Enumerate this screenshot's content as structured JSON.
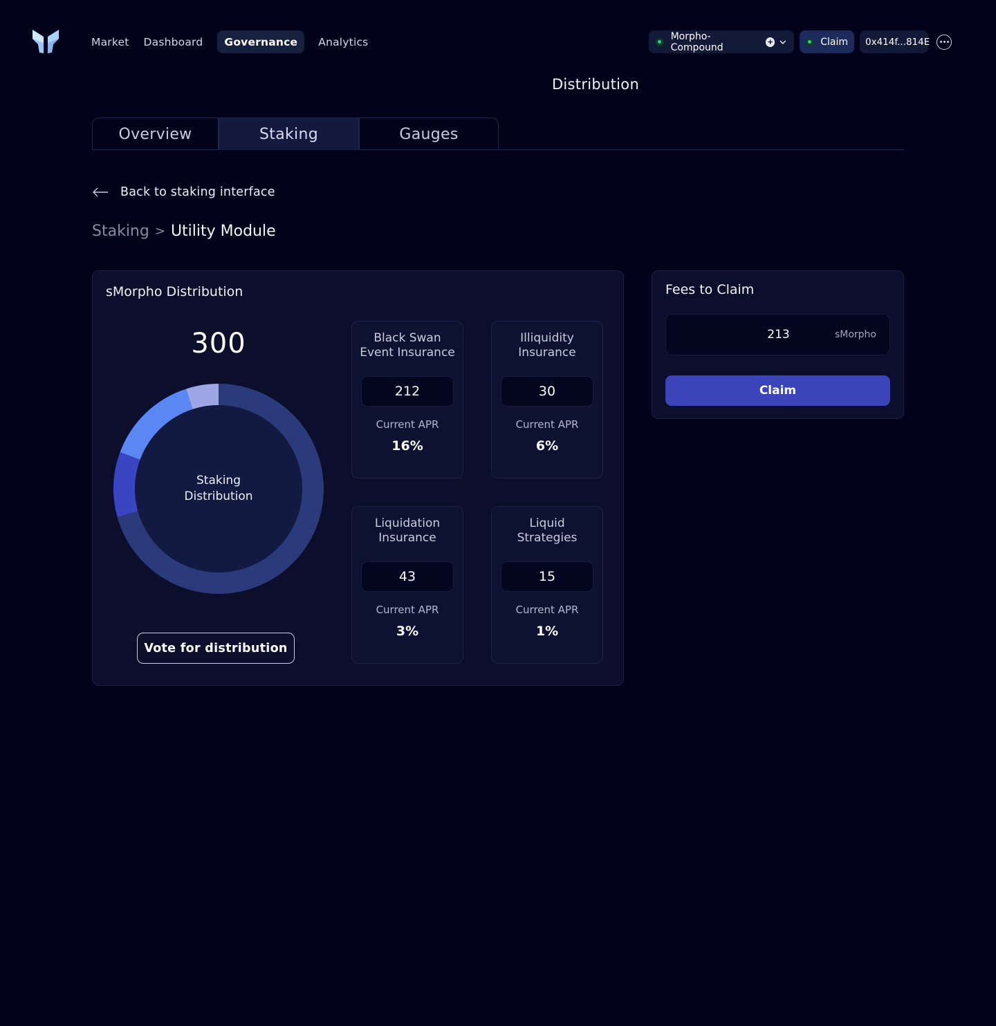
{
  "nav": {
    "items": [
      {
        "label": "Market"
      },
      {
        "label": "Dashboard"
      },
      {
        "label": "Governance",
        "active": true
      },
      {
        "label": "Analytics"
      }
    ]
  },
  "header": {
    "network": "Morpho-Compound",
    "claim_label": "Claim",
    "address": "0x414f...814E",
    "network_icon": "green-dot-icon",
    "more_icon": "more-icon"
  },
  "page": {
    "title": "Distribution",
    "tabs": [
      {
        "label": "Overview"
      },
      {
        "label": "Staking",
        "active": true
      },
      {
        "label": "Gauges"
      }
    ],
    "back_label": "Back to staking interface",
    "breadcrumb": {
      "parent": "Staking",
      "separator": ">",
      "current": "Utility Module"
    }
  },
  "distribution": {
    "title": "sMorpho Distribution",
    "total": "300",
    "donut_label_line1": "Staking",
    "donut_label_line2": "Distribution",
    "vote_label": "Vote for distribution",
    "segments": [
      {
        "name": "Black Swan Event Insurance",
        "value": 212,
        "color": "#2b3a7a"
      },
      {
        "name": "Illiquidity Insurance",
        "value": 30,
        "color": "#3a45c4"
      },
      {
        "name": "Liquidation Insurance",
        "value": 43,
        "color": "#5b87f5"
      },
      {
        "name": "Liquid Strategies",
        "value": 15,
        "color": "#9ea6e6"
      }
    ],
    "modules": [
      {
        "title_line1": "Black Swan",
        "title_line2": "Event Insurance",
        "value": "212",
        "apr_label": "Current APR",
        "apr": "16%"
      },
      {
        "title_line1": "Illiquidity",
        "title_line2": "Insurance",
        "value": "30",
        "apr_label": "Current APR",
        "apr": "6%"
      },
      {
        "title_line1": "Liquidation",
        "title_line2": "Insurance",
        "value": "43",
        "apr_label": "Current APR",
        "apr": "3%"
      },
      {
        "title_line1": "Liquid",
        "title_line2": "Strategies",
        "value": "15",
        "apr_label": "Current APR",
        "apr": "1%"
      }
    ]
  },
  "fees": {
    "title": "Fees to Claim",
    "amount": "213",
    "unit": "sMorpho",
    "claim_label": "Claim"
  },
  "colors": {
    "background": "#02031a",
    "card": "#0b0f2b",
    "accent": "#3b44b8"
  }
}
